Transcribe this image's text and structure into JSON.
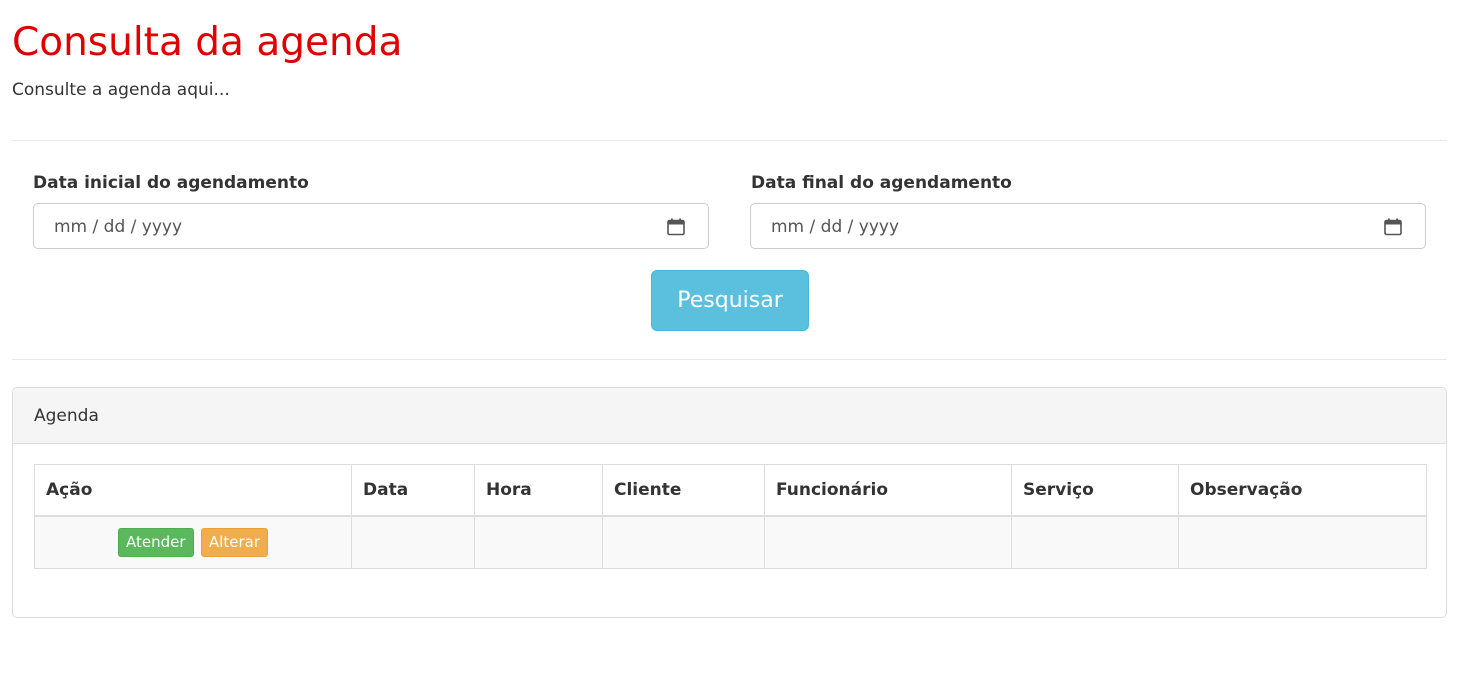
{
  "header": {
    "title": "Consulta da agenda",
    "subtitle": "Consulte a agenda aqui..."
  },
  "filters": {
    "start_date": {
      "label": "Data inicial do agendamento",
      "placeholder": "mm / dd / yyyy",
      "value": "",
      "icon": "calendar-icon"
    },
    "end_date": {
      "label": "Data final do agendamento",
      "placeholder": "mm / dd / yyyy",
      "value": "",
      "icon": "calendar-icon"
    },
    "search_button": "Pesquisar"
  },
  "panel": {
    "title": "Agenda",
    "table": {
      "columns": [
        "Ação",
        "Data",
        "Hora",
        "Cliente",
        "Funcionário",
        "Serviço",
        "Observação"
      ],
      "rows": [
        {
          "actions": [
            "Atender",
            "Alterar"
          ],
          "data": "",
          "hora": "",
          "cliente": "",
          "funcionario": "",
          "servico": "",
          "observacao": ""
        }
      ]
    }
  },
  "colors": {
    "title": "#e00000",
    "search_button": "#5bc0de",
    "attend_button": "#5cb85c",
    "edit_button": "#f0ad4e"
  }
}
